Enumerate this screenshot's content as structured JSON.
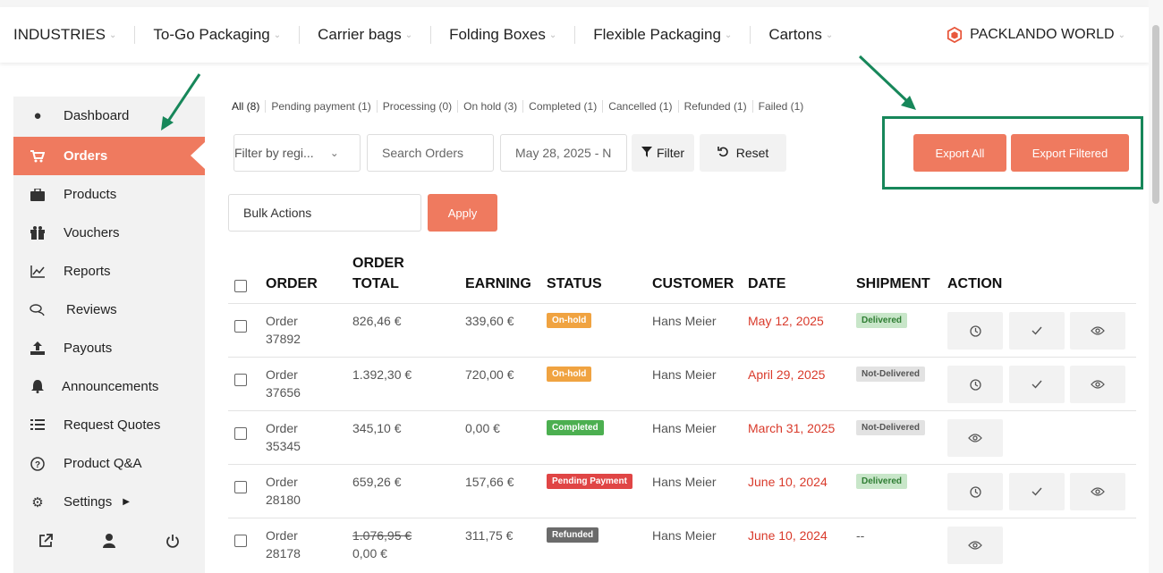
{
  "topnav": {
    "items": [
      {
        "label": "INDUSTRIES"
      },
      {
        "label": "To-Go Packaging"
      },
      {
        "label": "Carrier bags"
      },
      {
        "label": "Folding Boxes"
      },
      {
        "label": "Flexible Packaging"
      },
      {
        "label": "Cartons"
      }
    ],
    "brand": "PACKLANDO WORLD"
  },
  "sidebar": {
    "items": [
      {
        "label": "Dashboard",
        "icon": "palette-icon"
      },
      {
        "label": "Orders",
        "icon": "cart-icon"
      },
      {
        "label": "Products",
        "icon": "briefcase-icon"
      },
      {
        "label": "Vouchers",
        "icon": "gift-icon"
      },
      {
        "label": "Reports",
        "icon": "chart-line-icon"
      },
      {
        "label": "Reviews",
        "icon": "comments-icon"
      },
      {
        "label": "Payouts",
        "icon": "upload-icon"
      },
      {
        "label": "Announcements",
        "icon": "bell-icon"
      },
      {
        "label": "Request Quotes",
        "icon": "list-icon"
      },
      {
        "label": "Product Q&A",
        "icon": "question-icon"
      },
      {
        "label": "Settings",
        "icon": "gear-icon"
      }
    ],
    "active": "Orders"
  },
  "status_tabs": [
    "All (8)",
    "Pending payment (1)",
    "Processing (0)",
    "On hold (3)",
    "Completed (1)",
    "Cancelled (1)",
    "Refunded (1)",
    "Failed (1)"
  ],
  "filters": {
    "region": "Filter by regi...",
    "search_placeholder": "Search Orders",
    "date": "May 28, 2025 - N",
    "filter_label": "Filter",
    "reset_label": "Reset",
    "export_all": "Export All",
    "export_filtered": "Export Filtered",
    "bulk_actions": "Bulk Actions",
    "apply": "Apply"
  },
  "table": {
    "headers": {
      "order": "ORDER",
      "total_1": "ORDER",
      "total_2": "TOTAL",
      "earning": "EARNING",
      "status": "STATUS",
      "customer": "CUSTOMER",
      "date": "DATE",
      "shipment": "SHIPMENT",
      "action": "ACTION"
    },
    "rows": [
      {
        "order_1": "Order",
        "order_2": "37892",
        "total": "826,46 €",
        "total_old": "",
        "earning": "339,60 €",
        "status": "On-hold",
        "status_color": "#f0a341",
        "customer": "Hans Meier",
        "date": "May 12, 2025",
        "shipment": "Delivered",
        "shipment_type": "delivered",
        "actions": [
          "clock",
          "check",
          "eye"
        ]
      },
      {
        "order_1": "Order",
        "order_2": "37656",
        "total": "1.392,30 €",
        "total_old": "",
        "earning": "720,00 €",
        "status": "On-hold",
        "status_color": "#f0a341",
        "customer": "Hans Meier",
        "date": "April 29, 2025",
        "shipment": "Not-Delivered",
        "shipment_type": "not",
        "actions": [
          "clock",
          "check",
          "eye"
        ]
      },
      {
        "order_1": "Order",
        "order_2": "35345",
        "total": "345,10 €",
        "total_old": "",
        "earning": "0,00 €",
        "status": "Completed",
        "status_color": "#4caf50",
        "customer": "Hans Meier",
        "date": "March 31, 2025",
        "shipment": "Not-Delivered",
        "shipment_type": "not",
        "actions": [
          "eye"
        ]
      },
      {
        "order_1": "Order",
        "order_2": "28180",
        "total": "659,26 €",
        "total_old": "",
        "earning": "157,66 €",
        "status": "Pending Payment",
        "status_color": "#e04545",
        "customer": "Hans Meier",
        "date": "June 10, 2024",
        "shipment": "Delivered",
        "shipment_type": "delivered",
        "actions": [
          "clock",
          "check",
          "eye"
        ]
      },
      {
        "order_1": "Order",
        "order_2": "28178",
        "total": "0,00 €",
        "total_old": "1.076,95 €",
        "earning": "311,75 €",
        "status": "Refunded",
        "status_color": "#6b6b6b",
        "customer": "Hans Meier",
        "date": "June 10, 2024",
        "shipment": "--",
        "shipment_type": "none",
        "actions": [
          "eye"
        ]
      }
    ]
  },
  "colors": {
    "accent": "#ef7a5f",
    "highlight": "#17875a",
    "date": "#d93a2b"
  }
}
